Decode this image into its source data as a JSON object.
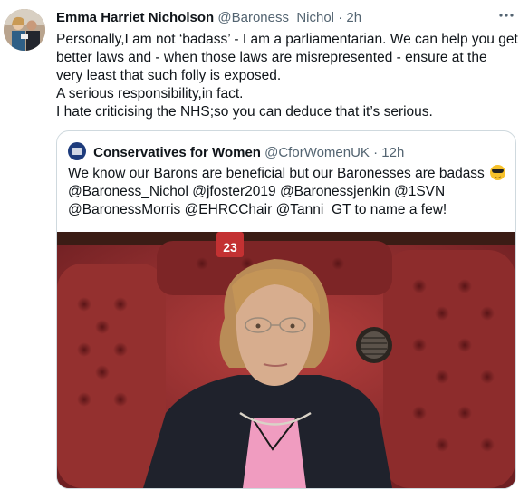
{
  "tweet": {
    "author_name": "Emma Harriet Nicholson",
    "author_handle": "@Baroness_Nichol",
    "separator": "·",
    "time": "2h",
    "more_icon": "more-icon",
    "lines": [
      "Personally,I am not ‘badass’ - I am a parliamentarian. We can help you get",
      "better laws and - when those laws are misrepresented - ensure at the",
      "very least that such folly is exposed.",
      "A serious responsibility,in fact.",
      "I hate criticising the NHS;so you can deduce that it’s serious."
    ]
  },
  "quoted": {
    "author_name": "Conservatives for Women",
    "author_handle": "@CforWomenUK",
    "separator": "·",
    "time": "12h",
    "lines": [
      "We know our Barons are beneficial but our Baronesses are badass",
      "@Baroness_Nichol @jfoster2019 @Baronessjenkin @1SVN",
      "@BaronessMorris @EHRCChair @Tanni_GT to name a few!"
    ],
    "emoji": "smiling-face-with-sunglasses",
    "photo_seat_number": "23"
  },
  "colors": {
    "text": "#0f1419",
    "secondary": "#536471",
    "border": "#cfd9de",
    "bench_red": "#8e2a2c"
  }
}
